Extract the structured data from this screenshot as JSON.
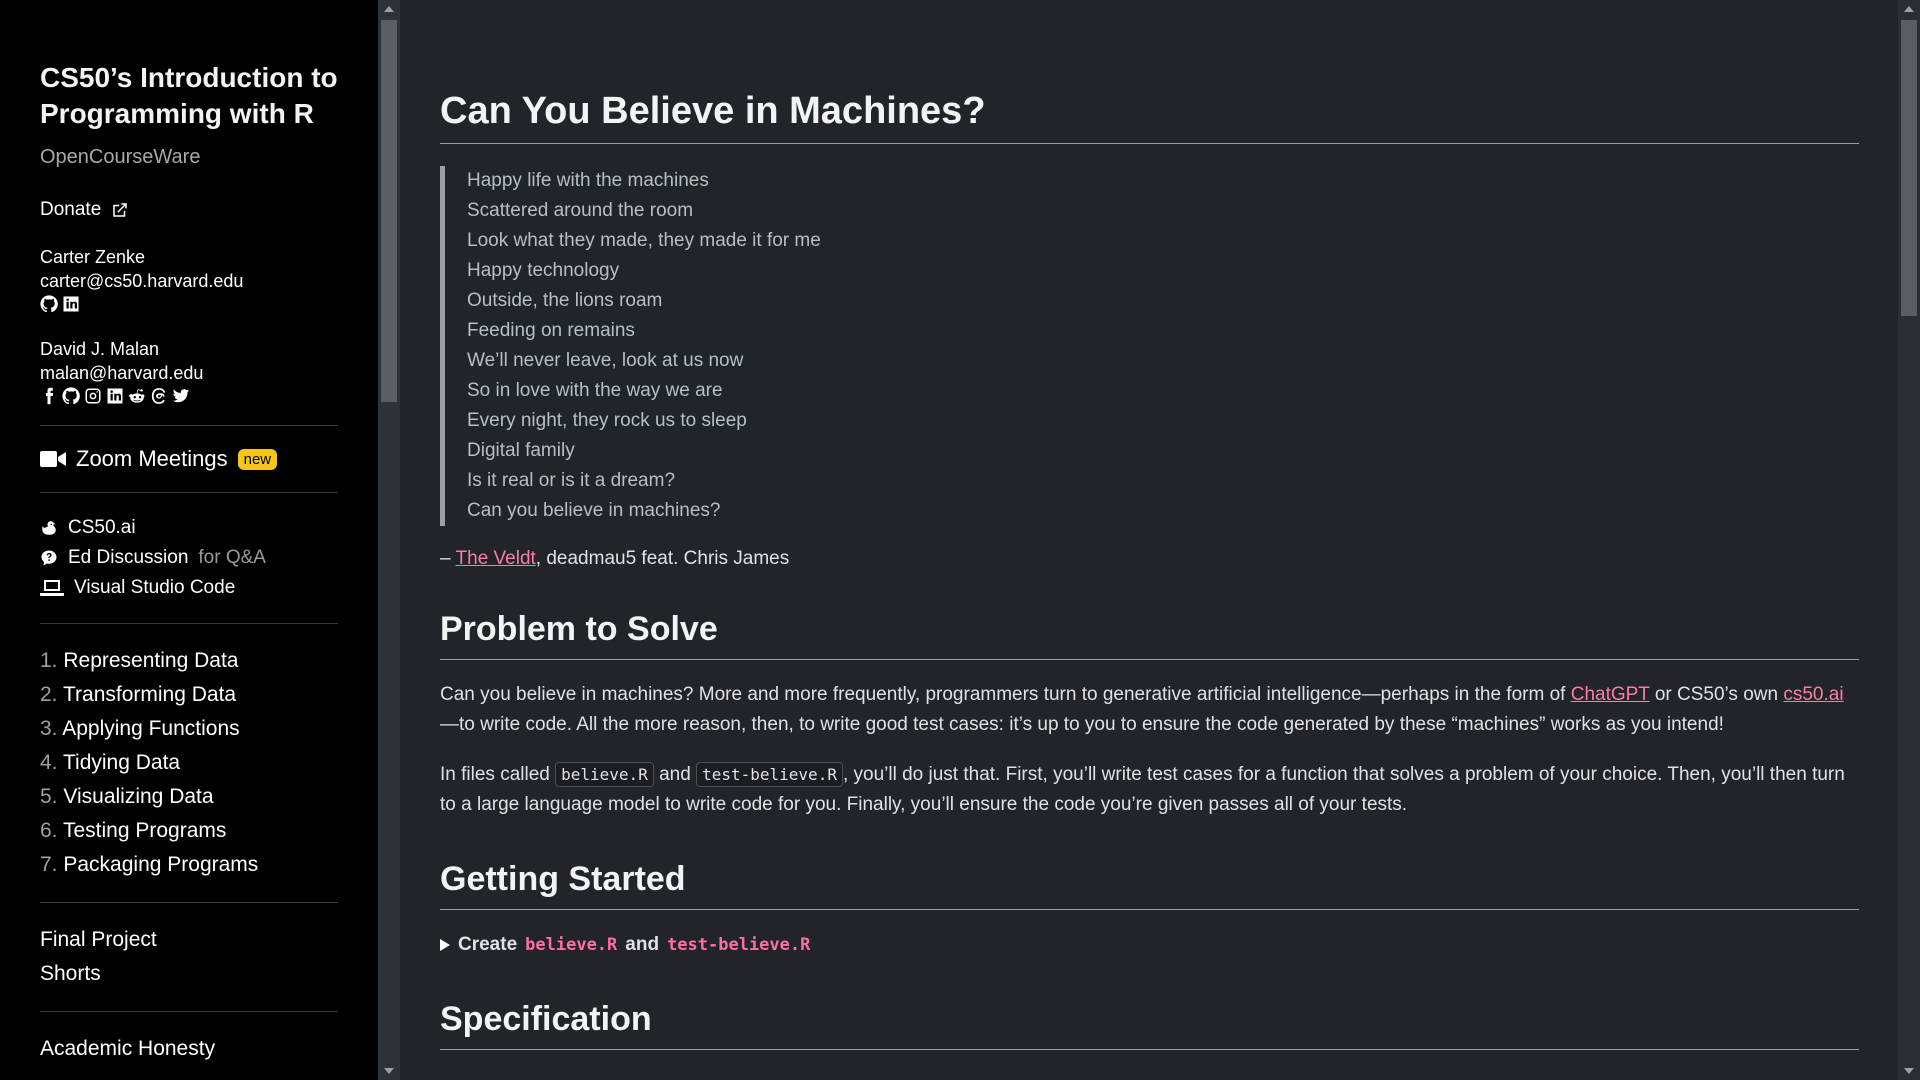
{
  "sidebar": {
    "title": "CS50’s Introduction to Programming with R",
    "subtitle": "OpenCourseWare",
    "donate": "Donate",
    "people": [
      {
        "name": "Carter Zenke",
        "email": "carter@cs50.harvard.edu",
        "icons": [
          "github-icon",
          "linkedin-icon"
        ]
      },
      {
        "name": "David J. Malan",
        "email": "malan@harvard.edu",
        "icons": [
          "facebook-icon",
          "github-icon",
          "instagram-icon",
          "linkedin-icon",
          "reddit-icon",
          "threads-icon",
          "twitter-icon"
        ]
      }
    ],
    "zoom": {
      "label": "Zoom Meetings",
      "badge": "new"
    },
    "tools": [
      {
        "label": "CS50.ai",
        "extra": ""
      },
      {
        "label": "Ed Discussion",
        "extra": "for Q&A"
      },
      {
        "label": "Visual Studio Code",
        "extra": ""
      }
    ],
    "weeks": [
      {
        "num": "1.",
        "label": "Representing Data"
      },
      {
        "num": "2.",
        "label": "Transforming Data"
      },
      {
        "num": "3.",
        "label": "Applying Functions"
      },
      {
        "num": "4.",
        "label": "Tidying Data"
      },
      {
        "num": "5.",
        "label": "Visualizing Data"
      },
      {
        "num": "6.",
        "label": "Testing Programs"
      },
      {
        "num": "7.",
        "label": "Packaging Programs"
      }
    ],
    "extras": [
      "Final Project",
      "Shorts"
    ],
    "honesty": "Academic Honesty"
  },
  "main": {
    "h1": "Can You Believe in Machines?",
    "lyrics": [
      "Happy life with the machines",
      "Scattered around the room",
      "Look what they made, they made it for me",
      "Happy technology",
      "Outside, the lions roam",
      "Feeding on remains",
      "We’ll never leave, look at us now",
      "So in love with the way we are",
      "Every night, they rock us to sleep",
      "Digital family",
      "Is it real or is it a dream?",
      "Can you believe in machines?"
    ],
    "attrib": {
      "dash": "– ",
      "link": "The Veldt",
      "rest": ", deadmau5 feat. Chris James"
    },
    "problem": {
      "heading": "Problem to Solve",
      "p1a": "Can you believe in machines? More and more frequently, programmers turn to generative artificial intelligence—perhaps in the form of ",
      "p1link1": "ChatGPT",
      "p1b": " or CS50’s own ",
      "p1link2": "cs50.ai",
      "p1c": " —to write code. All the more reason, then, to write good test cases: it’s up to you to ensure the code generated by these “machines” works as you intend!",
      "p2a": "In files called ",
      "p2code1": "believe.R",
      "p2b": " and ",
      "p2code2": "test-believe.R",
      "p2c": ", you’ll do just that. First, you’ll write test cases for a function that solves a problem of your choice. Then, you’ll then turn to a large language model to write code for you. Finally, you’ll ensure the code you’re given passes all of your tests."
    },
    "getting_started": {
      "heading": "Getting Started",
      "summary_a": "Create ",
      "code1": "believe.R",
      "summary_b": " and ",
      "code2": "test-believe.R"
    },
    "spec": {
      "heading": "Specification"
    }
  }
}
